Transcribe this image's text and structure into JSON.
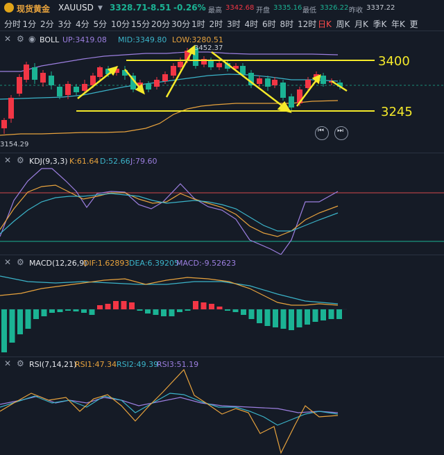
{
  "header": {
    "instrument_cn": "现货黄金",
    "symbol": "XAUUSD",
    "price": "3328.71",
    "change": "-8.51",
    "change_pct": "-0.26%",
    "high_label": "最高",
    "high": "3342.68",
    "open_label": "开盘",
    "open": "3335.16",
    "low_label": "最低",
    "low": "3326.22",
    "prev_label": "昨收",
    "prev": "3337.22"
  },
  "timeframes": [
    "分时",
    "1分",
    "2分",
    "3分",
    "4分",
    "5分",
    "10分",
    "15分",
    "20分",
    "30分",
    "1时",
    "2时",
    "3时",
    "4时",
    "6时",
    "8时",
    "12时",
    "日K",
    "周K",
    "月K",
    "季K",
    "年K",
    "更"
  ],
  "active_timeframe": "日K",
  "boll": {
    "title": "BOLL",
    "up_label": "UP:3419.08",
    "mid_label": "MID:3349.80",
    "low_label": "LOW:3280.51",
    "max_label": "3452.37",
    "min_label": "3154.29",
    "level_3400": "3400",
    "level_3245": "3245"
  },
  "kdj": {
    "title": "KDJ(9,3,3)",
    "k": "K:61.64",
    "d": "D:52.66",
    "j": "J:79.60"
  },
  "macd": {
    "title": "MACD(12,26,9)",
    "dif": "DIF:1.62893",
    "dea": "DEA:6.39205",
    "macd": "MACD:-9.52623"
  },
  "rsi": {
    "title": "RSI(7,14,21)",
    "rsi1": "RSI1:47.34",
    "rsi2": "RSI2:49.39",
    "rsi3": "RSI3:51.19"
  },
  "colors": {
    "up": "#f23645",
    "down": "#1bb394",
    "accent": "#ff4b4b",
    "annotation": "#f5ea2a",
    "purple": "#9c7fe0",
    "orange": "#e8a33d",
    "cyan": "#3bb4c9"
  },
  "icons": [
    "close-icon",
    "settings-icon",
    "eye-icon",
    "prev-button-icon",
    "next-button-icon"
  ]
}
